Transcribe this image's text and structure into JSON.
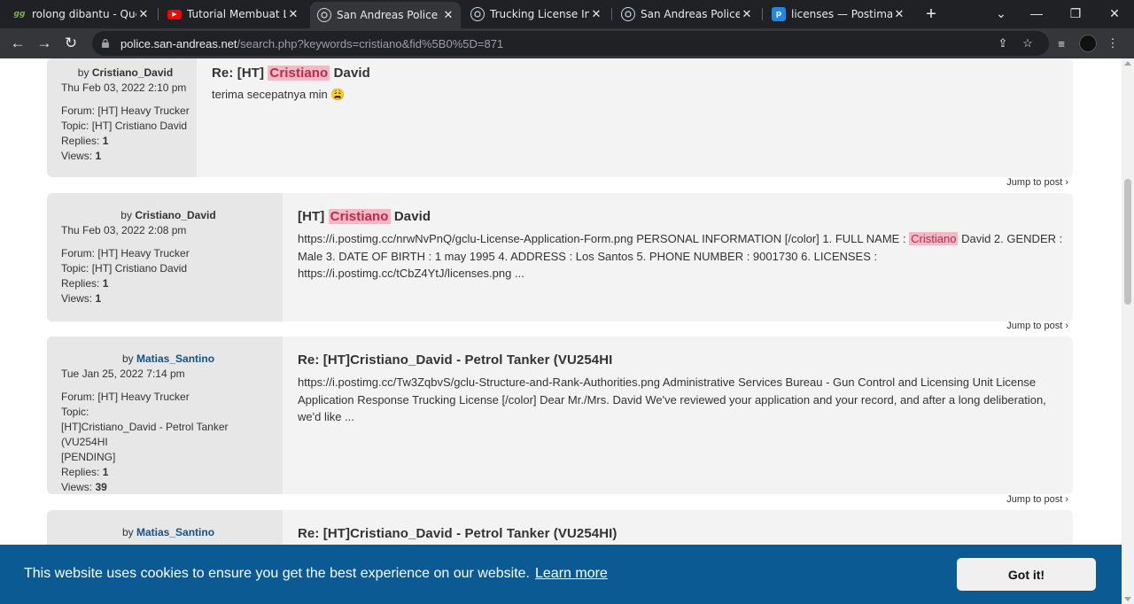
{
  "browser": {
    "tabs": [
      {
        "favicon": "gg-favicon",
        "fav_text": "gg",
        "title": "rolong dibantu - Quest",
        "close": "✕"
      },
      {
        "favicon": "youtube-favicon",
        "fav_text": "▶",
        "title": "Tutorial Membuat Lice",
        "close": "✕"
      },
      {
        "favicon": "sapd-favicon",
        "fav_text": "",
        "title": "San Andreas Police De",
        "close": "✕"
      },
      {
        "favicon": "sapd-favicon",
        "fav_text": "",
        "title": "Trucking License Inform",
        "close": "✕"
      },
      {
        "favicon": "sapd-favicon",
        "fav_text": "",
        "title": "San Andreas Police De",
        "close": "✕"
      },
      {
        "favicon": "postimages-favicon",
        "fav_text": "p",
        "title": "licenses — Postimages",
        "close": "✕"
      }
    ],
    "active_tab_index": 2,
    "new_tab": "+",
    "url_host": "police.san-andreas.net",
    "url_path": "/search.php?keywords=cristiano&fid%5B0%5D=871"
  },
  "posts": [
    {
      "by": "by",
      "author": "Cristiano_David",
      "author_color": "#333333",
      "date": "Thu Feb 03, 2022 2:10 pm",
      "forum_label": "Forum:",
      "forum": "[HT] Heavy Trucker",
      "topic_label": "Topic:",
      "topic": "[HT] Cristiano David",
      "replies_label": "Replies:",
      "replies": "1",
      "views_label": "Views:",
      "views": "1",
      "title_pre": "Re: [HT] ",
      "title_hl": "Cristiano",
      "title_post": " David",
      "body_pre": "terima secepatnya min ",
      "emoji": "😩",
      "jump": "Jump to post ›"
    },
    {
      "by": "by",
      "author": "Cristiano_David",
      "author_color": "#333333",
      "date": "Thu Feb 03, 2022 2:08 pm",
      "forum_label": "Forum:",
      "forum": "[HT] Heavy Trucker",
      "topic_label": "Topic:",
      "topic": "[HT] Cristiano David",
      "replies_label": "Replies:",
      "replies": "1",
      "views_label": "Views:",
      "views": "1",
      "title_pre": "[HT] ",
      "title_hl": "Cristiano",
      "title_post": " David",
      "body_line1_pre": "https://i.postimg.cc/nrwNvPnQ/gclu-License-Application-Form.png PERSONAL INFORMATION [/color] 1. FULL NAME : ",
      "body_line1_hl": "Cristiano",
      "body_line1_post": " David 2. GENDER :",
      "body_line2": "Male 3. DATE OF BIRTH : 1 may 1995 4. ADDRESS : Los Santos 5. PHONE NUMBER : 9001730 6. LICENSES :",
      "body_line3": "https://i.postimg.cc/tCbZ4YtJ/licenses.png ...",
      "jump": "Jump to post ›"
    },
    {
      "by": "by",
      "author": "Matias_Santino",
      "author_color": "#105289",
      "date": "Tue Jan 25, 2022 7:14 pm",
      "forum_label": "Forum:",
      "forum": "[HT] Heavy Trucker",
      "topic_label": "Topic:",
      "topic_line1": "[HT]Cristiano_David - Petrol Tanker (VU254HI",
      "topic_line2": "[PENDING]",
      "replies_label": "Replies:",
      "replies": "1",
      "views_label": "Views:",
      "views": "39",
      "title": "Re: [HT]Cristiano_David - Petrol Tanker (VU254HI",
      "body_line1": "https://i.postimg.cc/Tw3ZqbvS/gclu-Structure-and-Rank-Authorities.png Administrative Services Bureau - Gun Control and Licensing Unit License",
      "body_line2": "Application Response Trucking License [/color] Dear Mr./Mrs. David We've reviewed your application and your record, and after a long deliberation,",
      "body_line3": "we'd like ...",
      "jump": "Jump to post ›"
    },
    {
      "by": "by",
      "author": "Matias_Santino",
      "author_color": "#105289",
      "title": "Re: [HT]Cristiano_David - Petrol Tanker (VU254HI)"
    }
  ],
  "cookie": {
    "text": "This website uses cookies to ensure you get the best experience on our website.",
    "learn_more": "Learn more",
    "button": "Got it!",
    "bg_color": "#0b5a94"
  },
  "colors": {
    "highlight_bg": "#f4b9c5",
    "highlight_fg": "#bc2a4d",
    "link_blue": "#105289"
  }
}
